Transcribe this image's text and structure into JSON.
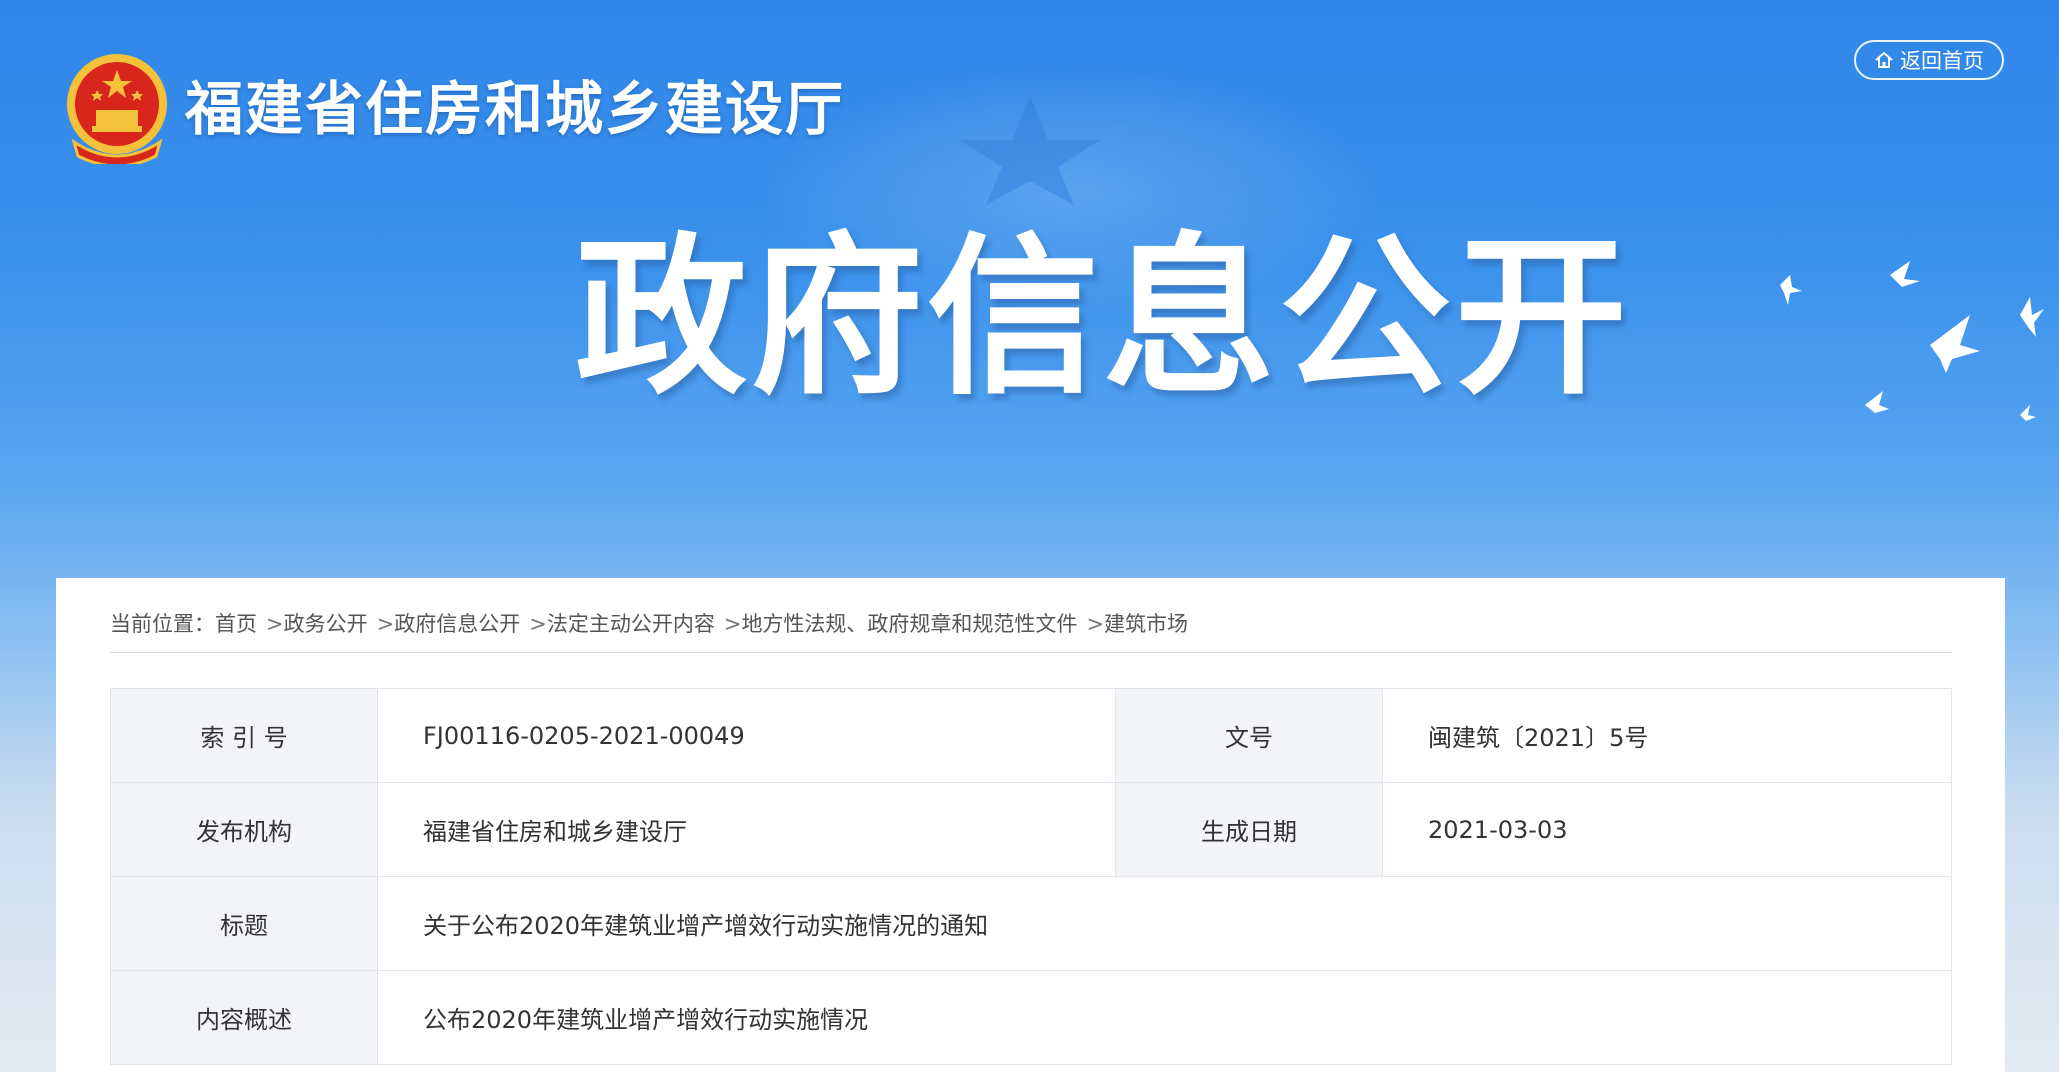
{
  "header": {
    "site_title": "福建省住房和城乡建设厅",
    "home_button": "返回首页",
    "hero_title": "政府信息公开"
  },
  "breadcrumb": {
    "prefix": "当前位置：",
    "items": [
      "首页",
      "政务公开",
      "政府信息公开",
      "法定主动公开内容",
      "地方性法规、政府规章和规范性文件",
      "建筑市场"
    ],
    "separator": ">"
  },
  "meta": {
    "index_label": "索 引 号",
    "index_value": "FJ00116-0205-2021-00049",
    "doc_no_label": "文号",
    "doc_no_value": "闽建筑〔2021〕5号",
    "publisher_label": "发布机构",
    "publisher_value": "福建省住房和城乡建设厅",
    "date_label": "生成日期",
    "date_value": "2021-03-03",
    "title_label": "标题",
    "title_value": "关于公布2020年建筑业增产增效行动实施情况的通知",
    "summary_label": "内容概述",
    "summary_value": "公布2020年建筑业增产增效行动实施情况"
  },
  "colors": {
    "banner_blue": "#2f86e8",
    "label_bg": "#f2f4f8",
    "emblem_red": "#d9261c",
    "emblem_gold": "#f3c13a"
  },
  "icons": {
    "emblem": "national-emblem-icon",
    "home": "home-icon"
  }
}
